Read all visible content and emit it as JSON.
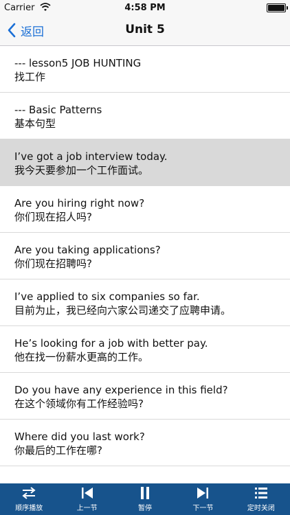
{
  "status": {
    "carrier": "Carrier",
    "time": "4:58 PM"
  },
  "nav": {
    "back_label": "返回",
    "title": "Unit 5"
  },
  "rows": [
    {
      "en": "--- lesson5  JOB HUNTING",
      "zh": "找工作"
    },
    {
      "en": "--- Basic Patterns",
      "zh": "基本句型"
    },
    {
      "en": "I’ve got a job interview today.",
      "zh": "我今天要参加一个工作面试。"
    },
    {
      "en": "Are you hiring right now?",
      "zh": "你们现在招人吗?"
    },
    {
      "en": "Are you taking applications?",
      "zh": "你们现在招聘吗?"
    },
    {
      "en": "I’ve applied to six companies so far.",
      "zh": "目前为止，我已经向六家公司递交了应聘申请。"
    },
    {
      "en": "He’s looking for a job with better pay.",
      "zh": "他在找一份薪水更高的工作。"
    },
    {
      "en": "Do you have any experience in this field?",
      "zh": "在这个领域你有工作经验吗?"
    },
    {
      "en": "Where did you last work?",
      "zh": "你最后的工作在哪?"
    }
  ],
  "toolbar": {
    "order_label": "顺序播放",
    "prev_label": "上一节",
    "pause_label": "暂停",
    "next_label": "下一节",
    "timer_label": "定时关闭"
  },
  "colors": {
    "accent": "#1a6fd6",
    "toolbar_bg": "#17538c",
    "selected_row": "#d9d9d9"
  }
}
